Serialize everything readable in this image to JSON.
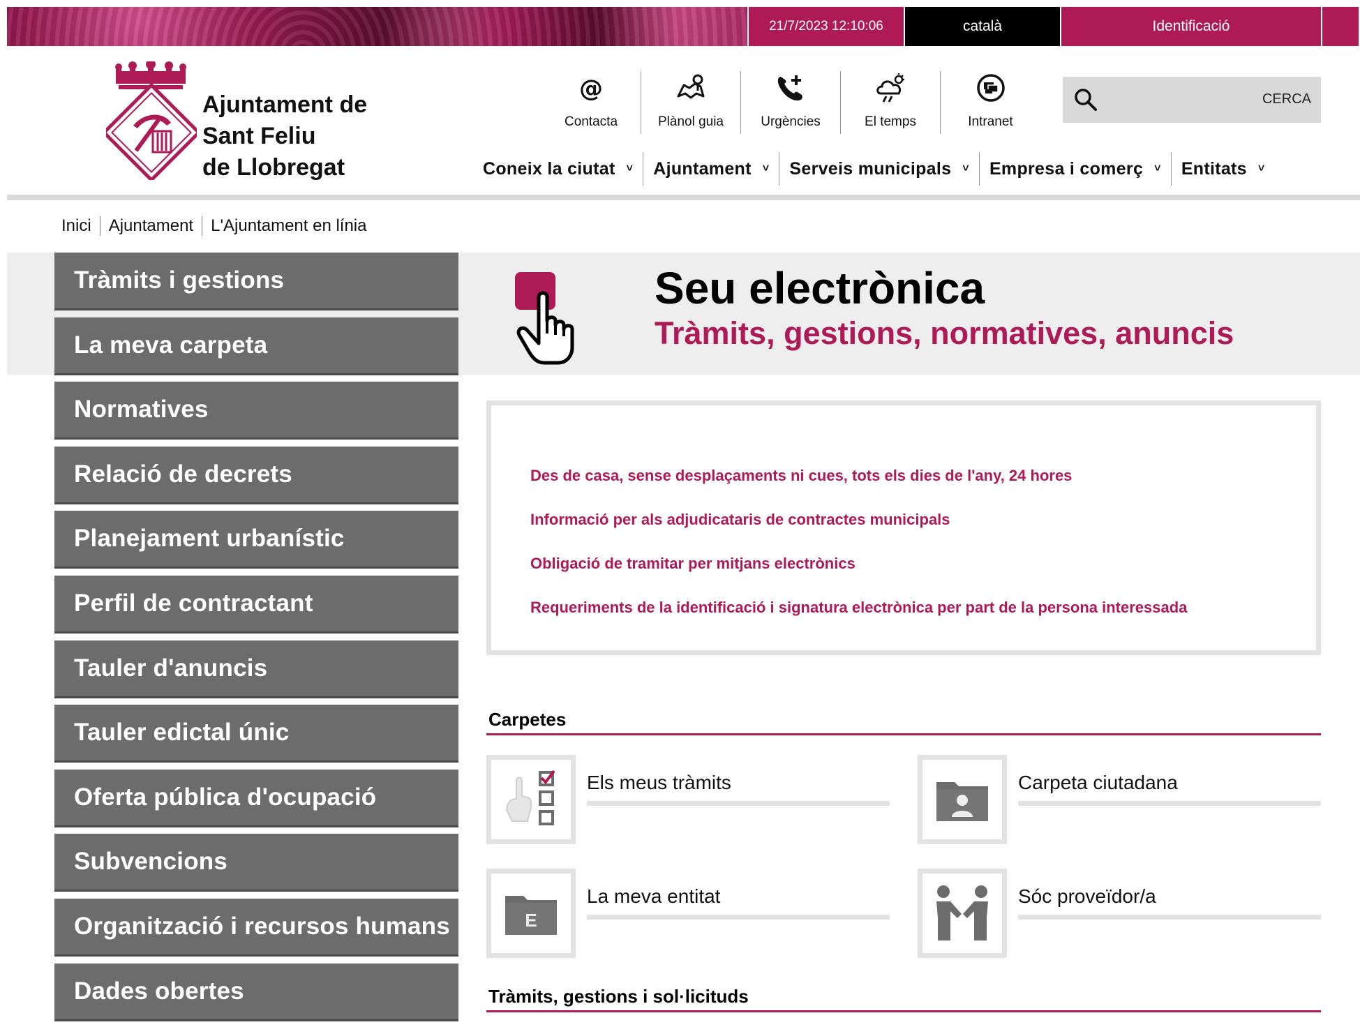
{
  "topbar": {
    "datetime": "21/7/2023 12:10:06",
    "language": "català",
    "login": "Identificació"
  },
  "header": {
    "org_name_line1": "Ajuntament de",
    "org_name_line2": "Sant Feliu",
    "org_name_line3": "de Llobregat",
    "quicklinks": [
      {
        "label": "Contacta",
        "icon": "at-icon"
      },
      {
        "label": "Plànol guia",
        "icon": "map-icon"
      },
      {
        "label": "Urgències",
        "icon": "phone-icon"
      },
      {
        "label": "El temps",
        "icon": "weather-icon"
      },
      {
        "label": "Intranet",
        "icon": "intranet-icon"
      }
    ],
    "search_button": "CERCA",
    "nav": [
      {
        "label": "Coneix la ciutat"
      },
      {
        "label": "Ajuntament"
      },
      {
        "label": "Serveis municipals"
      },
      {
        "label": "Empresa i comerç"
      },
      {
        "label": "Entitats"
      }
    ],
    "chevron": "˅"
  },
  "breadcrumb": [
    "Inici",
    "Ajuntament",
    "L'Ajuntament en línia"
  ],
  "sidebar": {
    "items": [
      {
        "label": "Tràmits i gestions"
      },
      {
        "label": "La meva carpeta"
      },
      {
        "label": "Normatives"
      },
      {
        "label": "Relació de decrets"
      },
      {
        "label": "Planejament urbanístic"
      },
      {
        "label": "Perfil de contractant"
      },
      {
        "label": "Tauler d'anuncis"
      },
      {
        "label": "Tauler edictal únic"
      },
      {
        "label": "Oferta pública d'ocupació"
      },
      {
        "label": "Subvencions"
      },
      {
        "label": "Organització i recursos humans"
      },
      {
        "label": "Dades obertes"
      }
    ]
  },
  "hero": {
    "title": "Seu electrònica",
    "subtitle": "Tràmits, gestions, normatives, anuncis"
  },
  "info_links": [
    {
      "label": "Des de casa, sense desplaçaments ni cues, tots els dies de l'any, 24 hores"
    },
    {
      "label": "Informació per als adjudicataris de contractes municipals"
    },
    {
      "label": "Obligació de tramitar per mitjans electrònics"
    },
    {
      "label": "Requeriments de la identificació i signatura electrònica per part de la persona interessada"
    }
  ],
  "carpetes": {
    "title": "Carpetes",
    "items": [
      {
        "label": "Els meus tràmits",
        "icon": "checklist-icon"
      },
      {
        "label": "Carpeta ciutadana",
        "icon": "citizen-folder-icon"
      },
      {
        "label": "La meva entitat",
        "icon": "entity-folder-icon"
      },
      {
        "label": "Sóc proveïdor/a",
        "icon": "handshake-icon"
      }
    ]
  },
  "tramits": {
    "title": "Tràmits, gestions i sol·licituds"
  },
  "colors": {
    "accent": "#ad1a55",
    "sidebar_bg": "#6c6c6c",
    "band_bg": "#eeeeee"
  }
}
